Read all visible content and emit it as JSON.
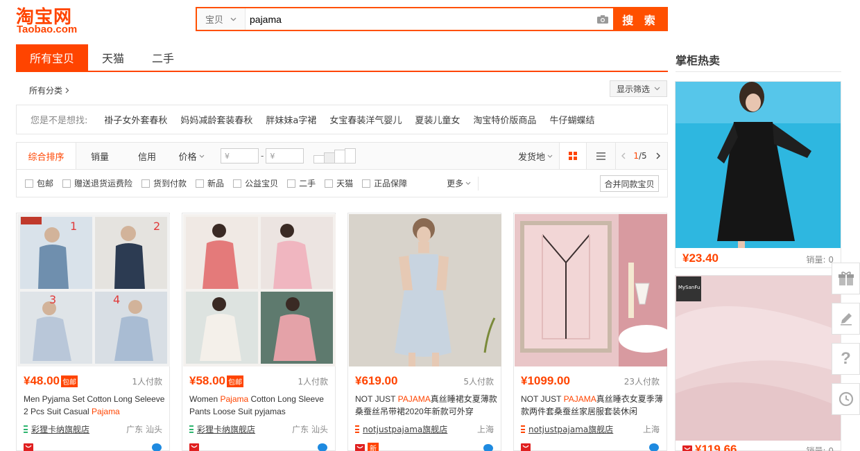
{
  "brand": {
    "logo_cn": "淘宝网",
    "logo_en": "Taobao.com",
    "color": "#ff4400"
  },
  "search": {
    "type_label": "宝贝",
    "query": "pajama",
    "button": "搜 索"
  },
  "tabs": [
    {
      "label": "所有宝贝",
      "active": true
    },
    {
      "label": "天猫",
      "active": false
    },
    {
      "label": "二手",
      "active": false
    }
  ],
  "category": {
    "all_label": "所有分类",
    "filter_label": "显示筛选"
  },
  "suggest": {
    "label": "您是不是想找:",
    "items": [
      "褂子女外套春秋",
      "妈妈减龄套装春秋",
      "胖妹妹a字裙",
      "女宝春装洋气婴儿",
      "夏装儿童女",
      "淘宝特价版商品",
      "牛仔蝴蝶结"
    ]
  },
  "sort": {
    "items": [
      "综合排序",
      "销量",
      "信用",
      "价格"
    ],
    "price_from": "¥",
    "price_sep": "-",
    "price_to": "¥",
    "ship_from": "发货地",
    "page_current": "1",
    "page_total": "/5"
  },
  "filters": {
    "checks": [
      "包邮",
      "赠送退货运费险",
      "货到付款",
      "新品",
      "公益宝贝",
      "二手",
      "天猫",
      "正品保障"
    ],
    "more": "更多",
    "merge": "合并同款宝贝"
  },
  "products": [
    {
      "price": "¥48.00",
      "baoyou": "包邮",
      "paid": "1人付款",
      "title_pre": "Men Pyjama Set Cotton Long Seleeve 2 Pcs Suit Casual ",
      "title_hl": "Pajama",
      "title_post": "",
      "shop": "彩狸卡纳旗舰店",
      "loc": "广东 汕头",
      "shop_color": "#2db56e"
    },
    {
      "price": "¥58.00",
      "baoyou": "包邮",
      "paid": "1人付款",
      "title_pre": "Women ",
      "title_hl": "Pajama",
      "title_post": " Cotton Long Sleeve Pants Loose Suit pyjamas",
      "shop": "彩狸卡纳旗舰店",
      "loc": "广东 汕头",
      "shop_color": "#2db56e"
    },
    {
      "price": "¥619.00",
      "baoyou": "",
      "paid": "5人付款",
      "title_pre": "NOT JUST ",
      "title_hl": "PAJAMA",
      "title_post": "真丝睡裙女夏薄款桑蚕丝吊带裙2020年新款可外穿",
      "shop": "notjustpajama旗舰店",
      "loc": "上海",
      "shop_color": "#ff4400"
    },
    {
      "price": "¥1099.00",
      "baoyou": "",
      "paid": "23人付款",
      "title_pre": "NOT JUST ",
      "title_hl": "PAJAMA",
      "title_post": "真丝睡衣女夏季薄款两件套桑蚕丝家居服套装休闲",
      "shop": "notjustpajama旗舰店",
      "loc": "上海",
      "shop_color": "#ff4400"
    }
  ],
  "product_badges": {
    "new": "新"
  },
  "hot": {
    "title": "掌柜热卖",
    "items": [
      {
        "price": "¥23.40",
        "sales": "销量: 0"
      },
      {
        "price": "¥119.66",
        "sales": "销量: 0"
      }
    ],
    "brand_tag": "MySanFu"
  },
  "thumb_numbers": [
    "1",
    "2",
    "3",
    "4"
  ]
}
